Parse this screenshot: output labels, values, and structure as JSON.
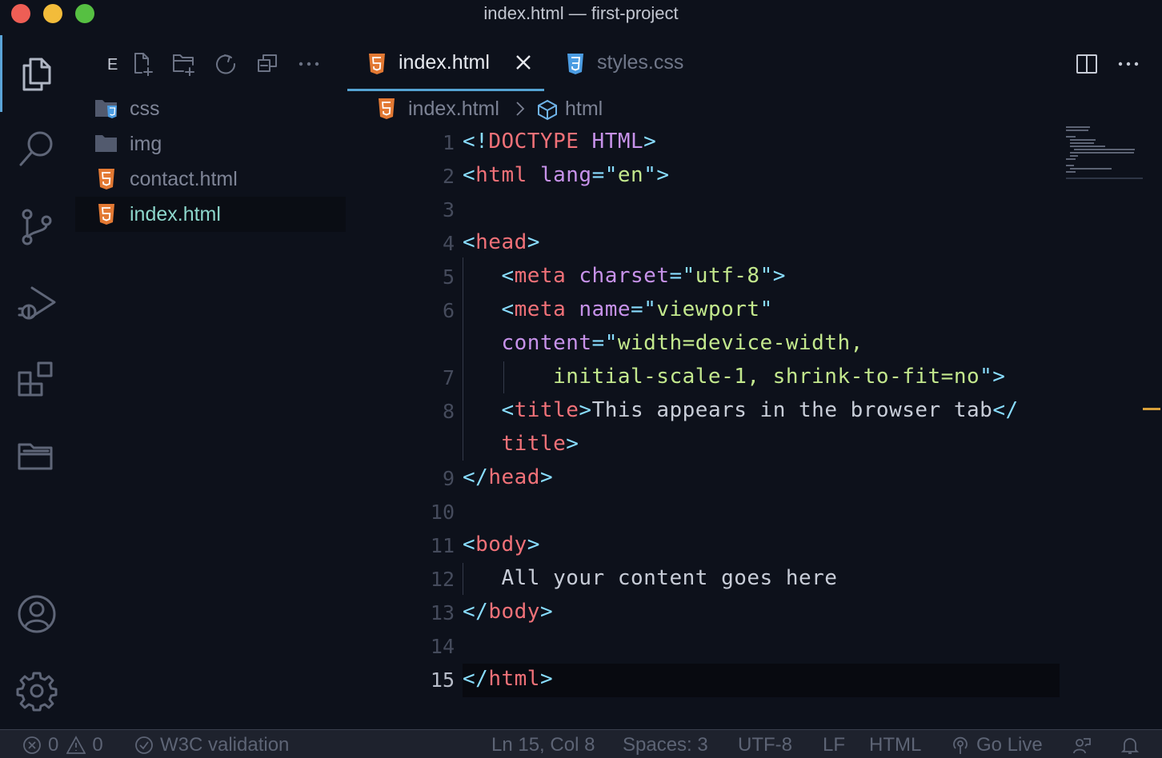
{
  "window": {
    "title": "index.html — first-project"
  },
  "sidebar": {
    "title": "E",
    "files": [
      {
        "name": "css",
        "type": "folder-css"
      },
      {
        "name": "img",
        "type": "folder"
      },
      {
        "name": "contact.html",
        "type": "html"
      },
      {
        "name": "index.html",
        "type": "html",
        "selected": true
      }
    ]
  },
  "tabs": [
    {
      "label": "index.html",
      "icon": "html5-icon",
      "active": true
    },
    {
      "label": "styles.css",
      "icon": "css3-icon",
      "active": false
    }
  ],
  "breadcrumb": {
    "file": "index.html",
    "symbol": "html"
  },
  "editor": {
    "current_line": "15",
    "line_numbers": [
      "1",
      "2",
      "3",
      "4",
      "5",
      "6",
      "",
      "7",
      "8",
      "",
      "9",
      "10",
      "11",
      "12",
      "13",
      "14",
      "15"
    ]
  },
  "statusbar": {
    "errors": "0",
    "warnings": "0",
    "validation": "W3C validation",
    "position": "Ln 15, Col 8",
    "spaces": "Spaces: 3",
    "encoding": "UTF-8",
    "eol": "LF",
    "language": "HTML",
    "go_live": "Go Live"
  },
  "colors": {
    "accent": "#55a3d3",
    "html_icon": "#e37933",
    "css_icon": "#4b9ce2",
    "background": "#0d111b"
  }
}
